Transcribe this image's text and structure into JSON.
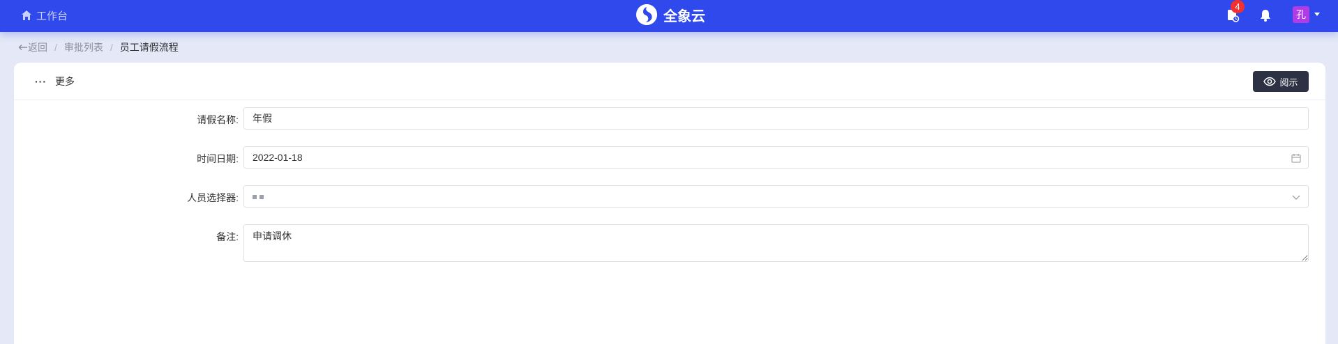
{
  "header": {
    "workbench_label": "工作台",
    "brand_name": "全象云",
    "notification_count": "4",
    "avatar_text": "孔"
  },
  "breadcrumb": {
    "back_label": "返回",
    "items": [
      "审批列表",
      "员工请假流程"
    ]
  },
  "toolbar": {
    "more_label": "更多",
    "view_label": "阅示"
  },
  "form": {
    "leave_name": {
      "label": "请假名称:",
      "value": "年假"
    },
    "date": {
      "label": "时间日期:",
      "value": "2022-01-18"
    },
    "person": {
      "label": "人员选择器:",
      "value": ""
    },
    "remark": {
      "label": "备注:",
      "value": "申请调休"
    }
  },
  "colors": {
    "topbar": "#2f49ec",
    "badge": "#f23030",
    "avatar": "#b13be6",
    "view_button": "#2c3244"
  }
}
